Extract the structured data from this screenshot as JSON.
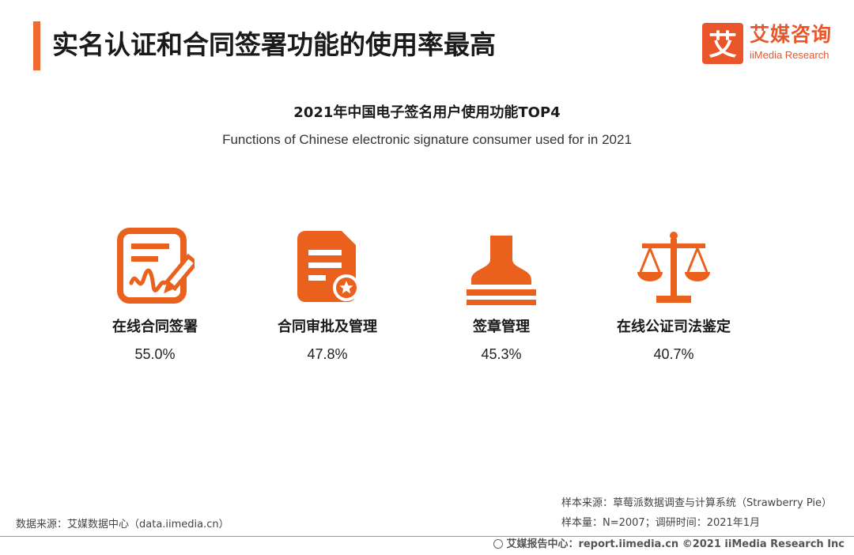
{
  "header": {
    "title": "实名认证和合同签署功能的使用率最高"
  },
  "logo": {
    "mark_char": "艾",
    "cn": "艾媒咨询",
    "en": "iiMedia Research",
    "color": "#e9562a"
  },
  "chart": {
    "title": "2021年中国电子签名用户使用功能TOP4",
    "subtitle": "Functions of Chinese electronic signature consumer used for in 2021"
  },
  "chart_data": {
    "type": "table",
    "title": "2021年中国电子签名用户使用功能TOP4",
    "subtitle": "Functions of Chinese electronic signature consumer used for in 2021",
    "categories": [
      "在线合同签署",
      "合同审批及管理",
      "签章管理",
      "在线公证司法鉴定"
    ],
    "values": [
      55.0,
      47.8,
      45.3,
      40.7
    ],
    "value_labels": [
      "55.0%",
      "47.8%",
      "45.3%",
      "40.7%"
    ],
    "icons": [
      "contract-signing-icon",
      "document-approval-icon",
      "stamp-icon",
      "scales-icon"
    ],
    "accent_color": "#e9611c"
  },
  "notes": {
    "source_left": "数据来源：艾媒数据中心（data.iimedia.cn）",
    "sample_source": "样本来源：草莓派数据调查与计算系统（Strawberry Pie）",
    "sample_size": "样本量：N=2007；调研时间：2021年1月"
  },
  "footer": {
    "text": "艾媒报告中心：report.iimedia.cn   ©2021  iiMedia Research  Inc"
  }
}
